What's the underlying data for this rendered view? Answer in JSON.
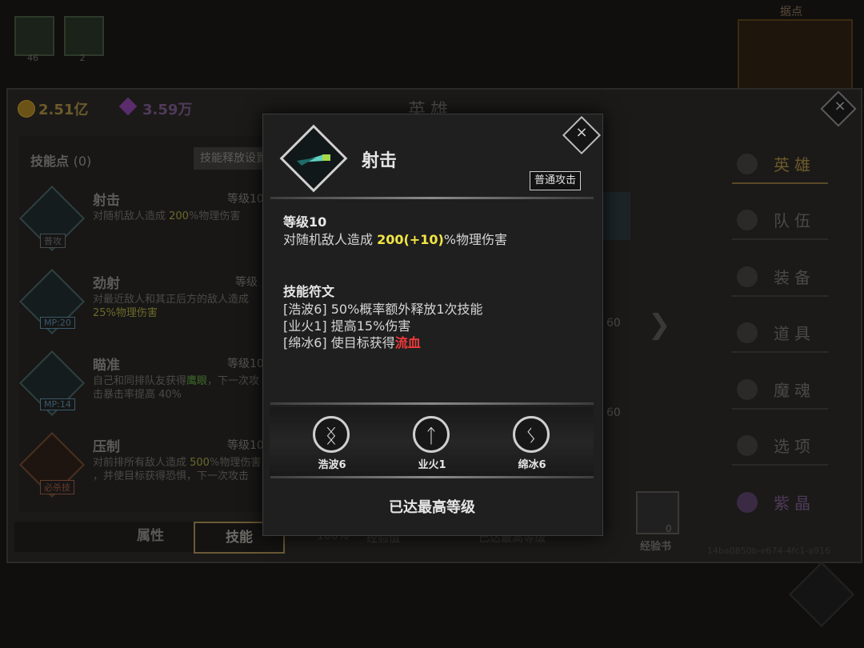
{
  "background": {
    "top_counts": [
      "46",
      "2"
    ],
    "map_label": "据点",
    "gold": "2.51亿",
    "gems": "3.59万",
    "panel_title": "英雄",
    "skill_points_label": "技能点",
    "skill_points_value": "(0)",
    "skill_setting_button": "技能释放设置",
    "skills": [
      {
        "name": "射击",
        "level": "等级10",
        "tag": "普攻",
        "desc_pre": "对随机敌人造成 ",
        "desc_hl": "200",
        "desc_post": "%物理伤害",
        "desc2": ""
      },
      {
        "name": "劲射",
        "level": "等级",
        "tag": "MP:20",
        "desc_pre": "对最近敌人和其正后方的敌人造成 ",
        "desc_hl": "",
        "desc_post": "",
        "desc2": "25%物理伤害"
      },
      {
        "name": "瞄准",
        "level": "等级10",
        "tag": "MP:14",
        "desc_pre": "自己和同排队友获得",
        "desc_hl": "鹰眼",
        "desc_post": "，下一次攻",
        "desc2": "击暴击率提高 40%"
      },
      {
        "name": "压制",
        "level": "等级10",
        "tag": "必杀技",
        "desc_pre": "对前排所有敌人造成 ",
        "desc_hl": "500",
        "desc_post": "%物理伤害",
        "desc2": "，并使目标获得恐惧，下一次攻击"
      }
    ],
    "bottom_tabs": [
      "属性",
      "技能"
    ],
    "side_nav": [
      "英雄",
      "队伍",
      "装备",
      "道具",
      "魔魂",
      "选项",
      "紫晶"
    ],
    "exp_row": [
      "100%",
      "经验值",
      "已达最高等级"
    ],
    "nums": [
      "60",
      "60"
    ],
    "exp_book_label": "经验书",
    "exp_book_count": "0",
    "uid": "14ba0850b-e674-4fc1-a916"
  },
  "modal": {
    "icon": "arrow-skill-icon",
    "title": "射击",
    "badge": "普通攻击",
    "level": "等级10",
    "desc_pre": "对随机敌人造成 ",
    "desc_value": "200(+10)",
    "desc_post": "%物理伤害",
    "rune_title": "技能符文",
    "rune_lines": [
      {
        "pre": "[浩波6] 50%概率额外释放1次技能",
        "hl": ""
      },
      {
        "pre": "[业火1] 提高15%伤害",
        "hl": ""
      },
      {
        "pre": "[绵冰6] 使目标获得",
        "hl": "流血"
      }
    ],
    "runes": [
      {
        "glyph": "ᛝ",
        "label": "浩波6"
      },
      {
        "glyph": "ᛏ",
        "label": "业火1"
      },
      {
        "glyph": "ᛊ",
        "label": "绵冰6"
      }
    ],
    "max_level_text": "已达最高等级"
  },
  "colors": {
    "highlight_yellow": "#f2e544",
    "highlight_red": "#f03a3a",
    "modal_bg": "#1f1f1f"
  }
}
